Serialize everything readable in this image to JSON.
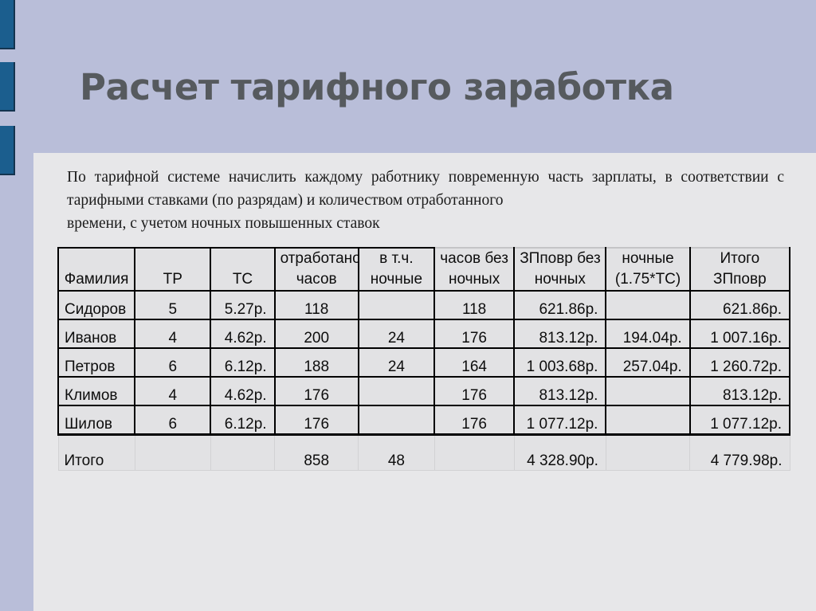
{
  "slide": {
    "title": "Расчет тарифного заработка",
    "body_line1": "По тарифной системе начислить каждому работнику повременную часть зарплаты, в соответствии с тарифными ставками (по разрядам) и количеством отработанного",
    "body_line2": "времени, с учетом ночных повышенных ставок",
    "accent_color": "#1b5e8e",
    "background_color": "#b9bed9",
    "panel_color": "#e7e7e9",
    "title_color": "#565a5e"
  },
  "table": {
    "headers": [
      {
        "line1": "",
        "line2": "Фамилия"
      },
      {
        "line1": "",
        "line2": "ТР"
      },
      {
        "line1": "",
        "line2": "ТС"
      },
      {
        "line1": "отработано",
        "line2": "часов"
      },
      {
        "line1": "в т.ч.",
        "line2": "ночные"
      },
      {
        "line1": "часов без",
        "line2": "ночных"
      },
      {
        "line1": "ЗПповр без",
        "line2": "ночных"
      },
      {
        "line1": "ночные",
        "line2": "(1.75*ТС)"
      },
      {
        "line1": "Итого",
        "line2": "ЗПповр"
      }
    ],
    "rows": [
      {
        "name": "Сидоров",
        "tr": "5",
        "ts": "5.27р.",
        "hours": "118",
        "night_hours": "",
        "hours_no_night": "118",
        "zp_no_night": "621.86р.",
        "night_pay": "",
        "total": "621.86р."
      },
      {
        "name": "Иванов",
        "tr": "4",
        "ts": "4.62р.",
        "hours": "200",
        "night_hours": "24",
        "hours_no_night": "176",
        "zp_no_night": "813.12р.",
        "night_pay": "194.04р.",
        "total": "1 007.16р."
      },
      {
        "name": "Петров",
        "tr": "6",
        "ts": "6.12р.",
        "hours": "188",
        "night_hours": "24",
        "hours_no_night": "164",
        "zp_no_night": "1 003.68р.",
        "night_pay": "257.04р.",
        "total": "1 260.72р."
      },
      {
        "name": "Климов",
        "tr": "4",
        "ts": "4.62р.",
        "hours": "176",
        "night_hours": "",
        "hours_no_night": "176",
        "zp_no_night": "813.12р.",
        "night_pay": "",
        "total": "813.12р."
      },
      {
        "name": "Шилов",
        "tr": "6",
        "ts": "6.12р.",
        "hours": "176",
        "night_hours": "",
        "hours_no_night": "176",
        "zp_no_night": "1 077.12р.",
        "night_pay": "",
        "total": "1 077.12р."
      }
    ],
    "totals": {
      "name": "Итого",
      "tr": "",
      "ts": "",
      "hours": "858",
      "night_hours": "48",
      "hours_no_night": "",
      "zp_no_night": "4 328.90р.",
      "night_pay": "",
      "total": "4 779.98р."
    }
  }
}
